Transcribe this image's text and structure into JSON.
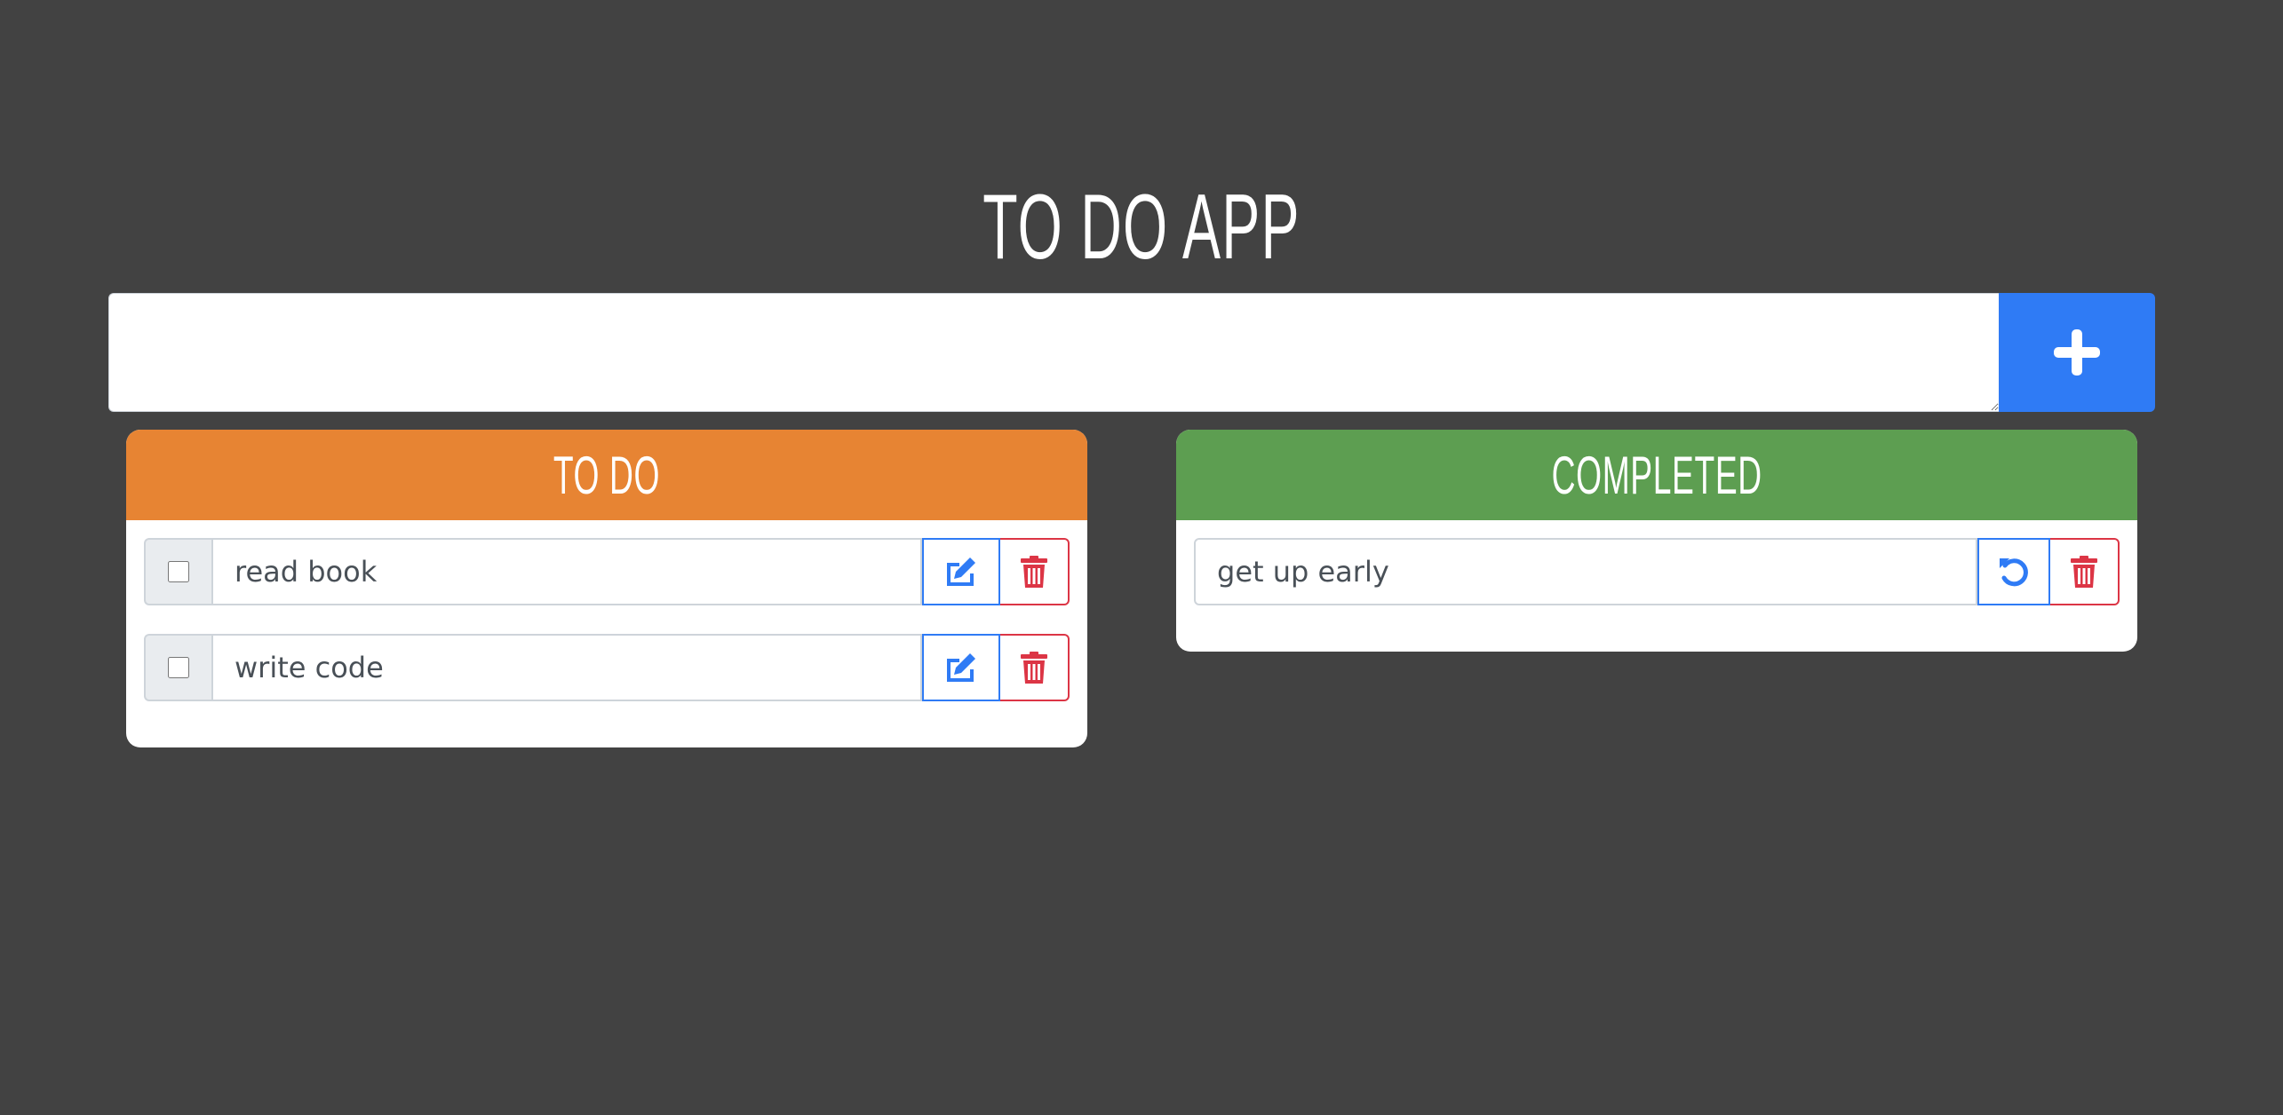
{
  "app": {
    "title": "TO DO APP"
  },
  "new_task": {
    "value": "",
    "add_icon": "plus-icon"
  },
  "todo": {
    "header": "TO DO",
    "accent": "#e78433",
    "items": [
      {
        "label": "read book",
        "checked": false
      },
      {
        "label": "write code",
        "checked": false
      }
    ]
  },
  "completed": {
    "header": "COMPLETED",
    "accent": "#5d9e51",
    "items": [
      {
        "label": "get up early"
      }
    ]
  },
  "colors": {
    "background": "#424242",
    "primary": "#2f7bf5",
    "danger": "#dc3545"
  },
  "icons": {
    "edit": "pencil-square-icon",
    "delete": "trash-icon",
    "undo": "undo-icon",
    "add": "plus-icon"
  }
}
